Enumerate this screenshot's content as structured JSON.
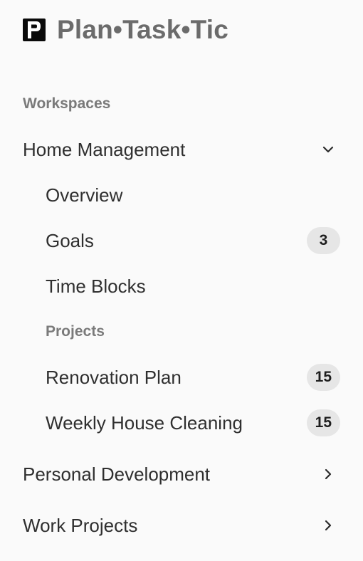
{
  "brand": {
    "logo_letter": "P",
    "name": "Plan•Task•Tic"
  },
  "sidebar": {
    "section_label": "Workspaces",
    "workspaces": [
      {
        "label": "Home Management",
        "expanded": true,
        "items": [
          {
            "label": "Overview"
          },
          {
            "label": "Goals",
            "count": "3"
          },
          {
            "label": "Time Blocks"
          }
        ],
        "projects_label": "Projects",
        "projects": [
          {
            "label": "Renovation Plan",
            "count": "15"
          },
          {
            "label": "Weekly House Cleaning",
            "count": "15"
          }
        ]
      },
      {
        "label": "Personal Development",
        "expanded": false
      },
      {
        "label": "Work Projects",
        "expanded": false
      }
    ]
  },
  "colors": {
    "background": "#fafafa",
    "logo": "#0a0a0a",
    "brand_text": "#6b6b6b",
    "badge_bg": "#e6e6e6"
  }
}
